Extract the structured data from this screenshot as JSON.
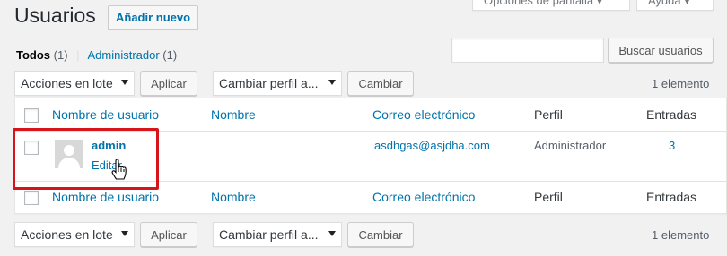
{
  "header": {
    "title": "Usuarios",
    "add_new_label": "Añadir nuevo",
    "screen_options_label": "Opciones de pantalla ▾",
    "help_label": "Ayuda ▾"
  },
  "filters": {
    "all_label": "Todos",
    "all_count": "(1)",
    "separator": "|",
    "admin_label": "Administrador",
    "admin_count": "(1)"
  },
  "search": {
    "value": "",
    "button_label": "Buscar usuarios"
  },
  "tablenav_top": {
    "bulk_action_selected": "Acciones en lote",
    "apply_label": "Aplicar",
    "role_selected": "Cambiar perfil a...",
    "change_label": "Cambiar",
    "items_count": "1 elemento"
  },
  "table": {
    "columns": [
      "Nombre de usuario",
      "Nombre",
      "Correo electrónico",
      "Perfil",
      "Entradas"
    ],
    "rows": [
      {
        "username": "admin",
        "edit_label": "Editar",
        "name": "",
        "email": "asdhgas@asjdha.com",
        "role": "Administrador",
        "posts": "3"
      }
    ]
  },
  "tablenav_bottom": {
    "bulk_action_selected": "Acciones en lote",
    "apply_label": "Aplicar",
    "role_selected": "Cambiar perfil a...",
    "change_label": "Cambiar",
    "items_count": "1 elemento"
  },
  "colors": {
    "link": "#0073aa",
    "highlight": "#d7141a",
    "background": "#f1f1f1"
  }
}
